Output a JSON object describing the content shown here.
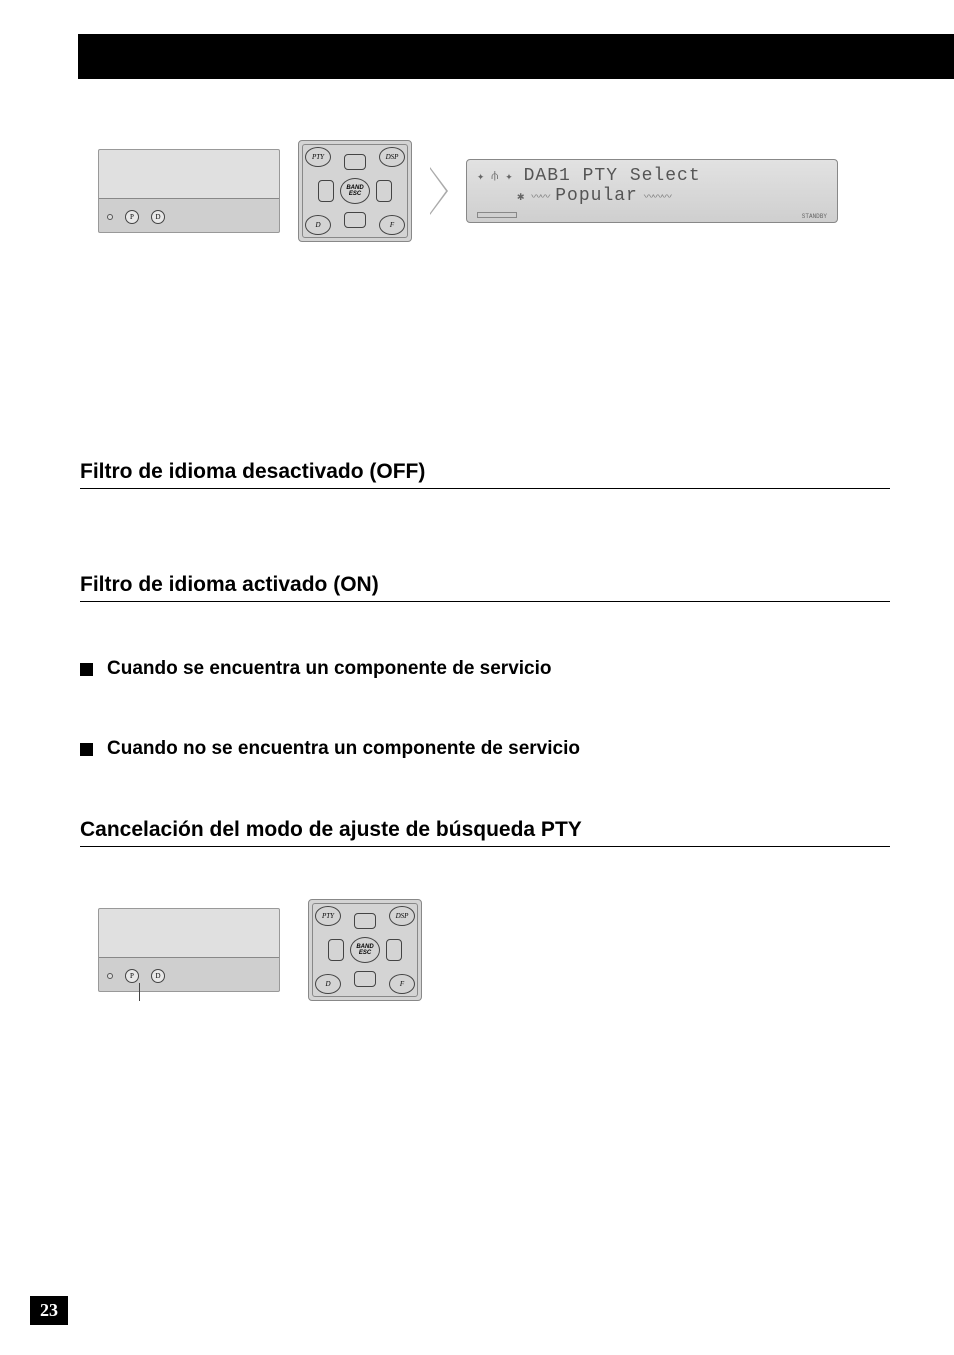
{
  "page_number": "23",
  "lcd": {
    "line1": "DAB1  PTY Select",
    "line2": "Popular",
    "standby_label": "STANDBY"
  },
  "remote": {
    "btn_pty": "PTY",
    "btn_dsp": "DSP",
    "btn_d": "D",
    "btn_f": "F",
    "btn_center": "BAND\nESC"
  },
  "panel": {
    "btn_p": "P",
    "btn_d": "D"
  },
  "headings": {
    "filter_off": "Filtro de idioma desactivado (OFF)",
    "filter_on": "Filtro de idioma activado (ON)",
    "cancel_mode": "Cancelación del modo de ajuste de búsqueda PTY"
  },
  "bullets": {
    "found": "Cuando se encuentra un componente de servicio",
    "not_found": "Cuando no se encuentra un componente de servicio"
  }
}
